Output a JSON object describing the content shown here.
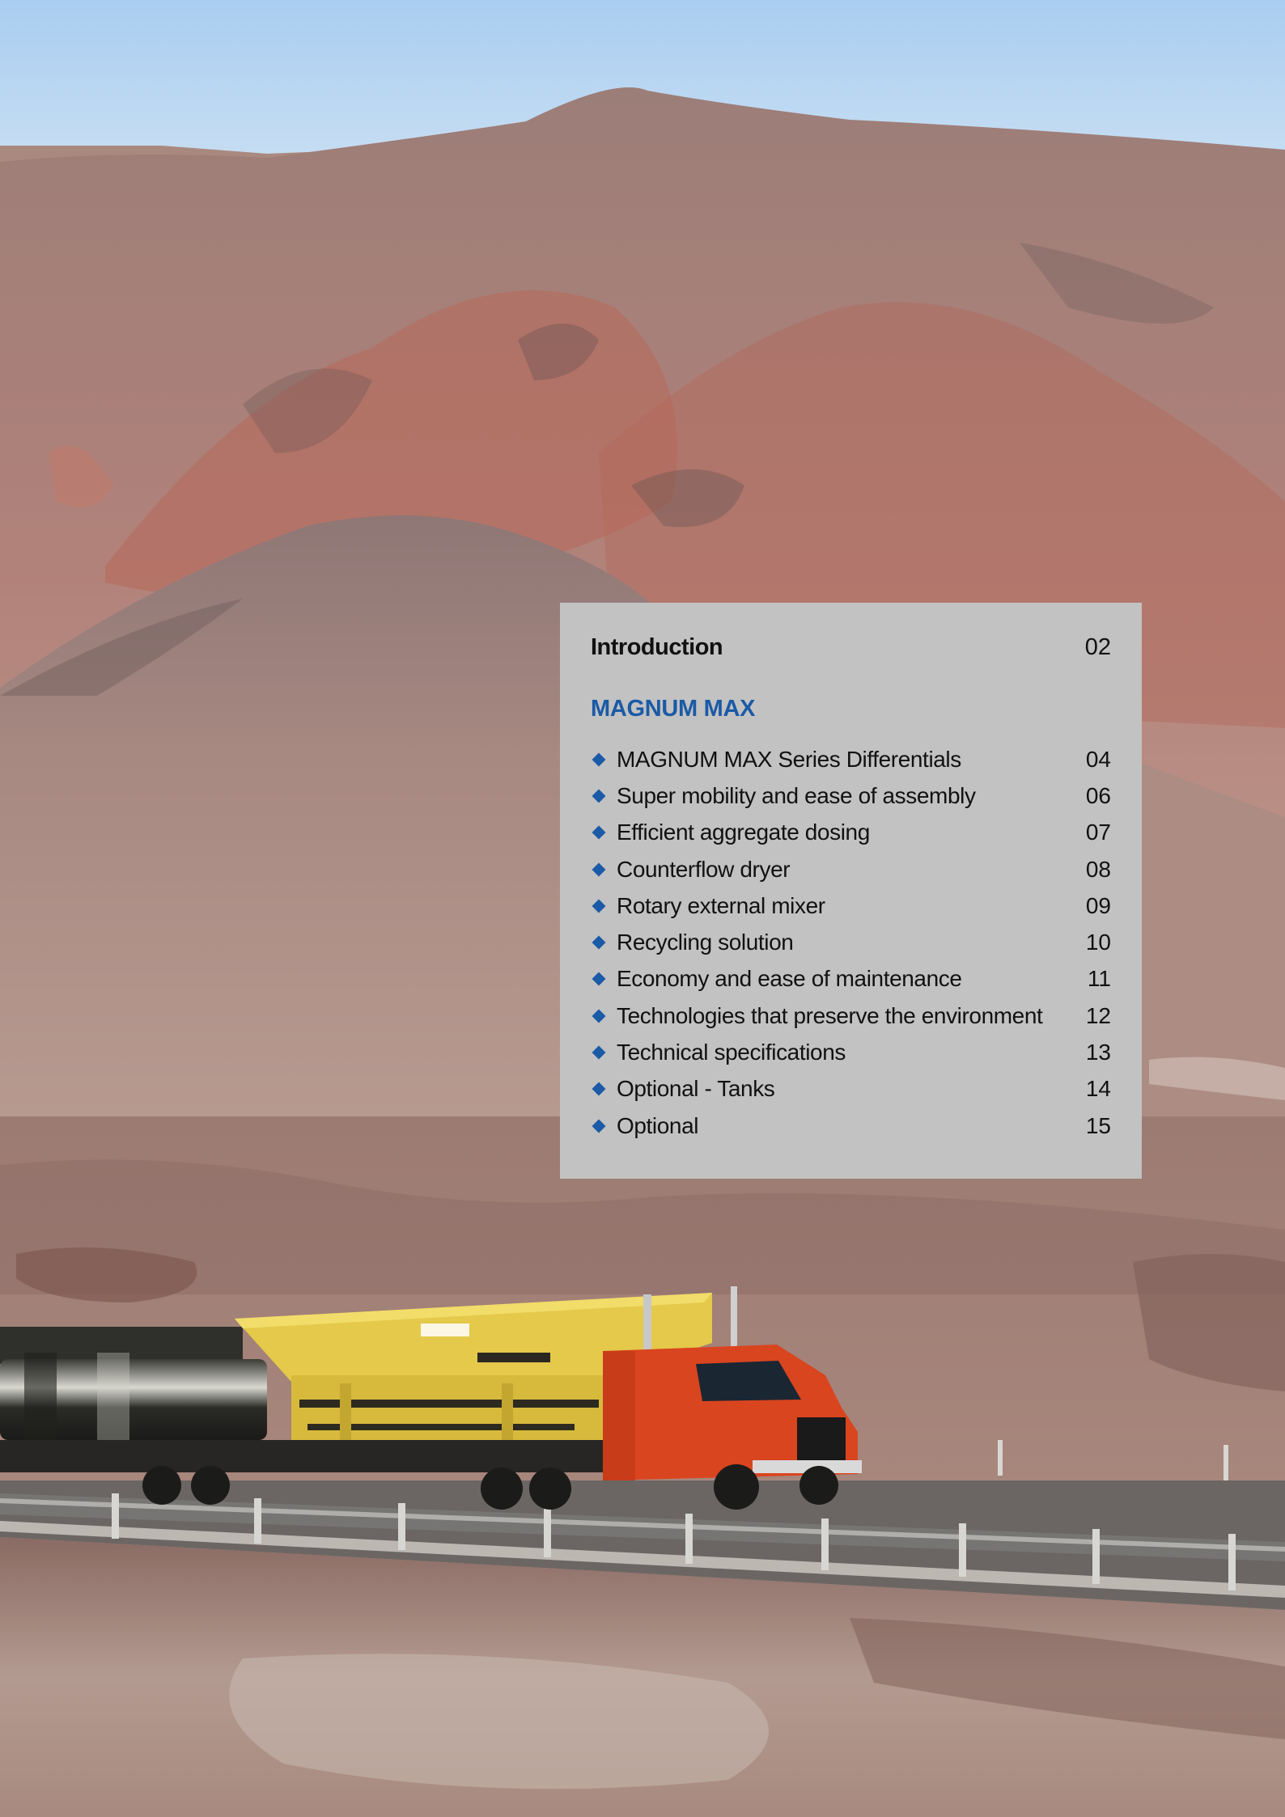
{
  "colors": {
    "panel_background": "#c2c2c2",
    "accent_blue": "#1b5aa6",
    "text": "#111111"
  },
  "background_image": {
    "icon": "desert-mountains-truck-photo"
  },
  "toc": {
    "intro": {
      "label": "Introduction",
      "page": "02"
    },
    "section_title": "MAGNUM MAX",
    "bullet_icon": "diamond-bullet-icon",
    "items": [
      {
        "label": "MAGNUM MAX Series Differentials",
        "page": "04"
      },
      {
        "label": "Super mobility and ease of assembly",
        "page": "06"
      },
      {
        "label": "Efficient aggregate dosing",
        "page": "07"
      },
      {
        "label": "Counterflow dryer",
        "page": "08"
      },
      {
        "label": "Rotary external mixer",
        "page": "09"
      },
      {
        "label": "Recycling solution",
        "page": "10"
      },
      {
        "label": "Economy and ease of maintenance",
        "page": "11"
      },
      {
        "label": "Technologies that preserve the environment",
        "page": "12"
      },
      {
        "label": "Technical specifications",
        "page": "13"
      },
      {
        "label": "Optional - Tanks",
        "page": "14"
      },
      {
        "label": "Optional",
        "page": "15"
      }
    ]
  }
}
